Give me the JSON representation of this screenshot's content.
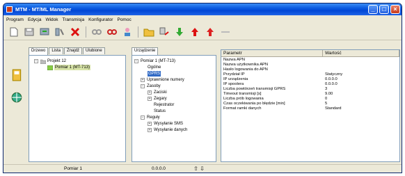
{
  "window": {
    "title": "MTM - MT/ML Manager",
    "minimize": "_",
    "maximize": "□",
    "close": "×"
  },
  "menu": [
    "Program",
    "Edycja",
    "Widok",
    "Transmisja",
    "Konfigurator",
    "Pomoc"
  ],
  "toolbar": {
    "icons": [
      "new-document-icon",
      "save-icon",
      "tree-connect-icon",
      "tree-disconnect-icon",
      "delete-icon",
      "link-icon",
      "link-red-icon",
      "user-icon",
      "folder-icon",
      "transfer-icon",
      "arrow-down-icon",
      "arrow-up-icon",
      "arrow-up-plus-icon",
      "minus-icon"
    ]
  },
  "left_panel": {
    "tabs": [
      "Drzewo",
      "Lista",
      "Znajdź",
      "Ulubione"
    ],
    "active_tab": "Drzewo",
    "tree": [
      {
        "label": "Projekt 12",
        "expander": "−"
      },
      {
        "label": "Pomiar 1 (MT-713)",
        "selected": true
      }
    ]
  },
  "mid_panel": {
    "tab": "Urządzenie",
    "tree": [
      {
        "label": "Pomiar 1 (MT-713)",
        "expander": "−"
      },
      {
        "label": "Ogólne"
      },
      {
        "label": "GPRS",
        "selected": true
      },
      {
        "label": "Uprawnione numery",
        "expander": "+"
      },
      {
        "label": "Zasoby",
        "expander": "−"
      },
      {
        "label": "Zaciski",
        "expander": "+"
      },
      {
        "label": "Zegary",
        "expander": "+"
      },
      {
        "label": "Rejestrator"
      },
      {
        "label": "Status"
      },
      {
        "label": "Reguły",
        "expander": "−"
      },
      {
        "label": "Wysyłanie SMS",
        "expander": "+"
      },
      {
        "label": "Wysyłanie danych",
        "expander": "+"
      }
    ]
  },
  "grid": {
    "headers": [
      "Parametr",
      "Wartość"
    ],
    "rows": [
      [
        "Nazwa APN",
        ""
      ],
      [
        "Nazwa użytkownika APN",
        ""
      ],
      [
        "Hasło logowania do APN",
        ""
      ],
      [
        "Przydział IP",
        "Statyczny"
      ],
      [
        "IP urządzenia",
        "0.0.0.0"
      ],
      [
        "IP spoolera",
        "0.0.0.0"
      ],
      [
        "Liczba powtórzeń transmisji GPRS",
        "3"
      ],
      [
        "Timeout transmisji [s]",
        "9.00"
      ],
      [
        "Liczba prób logowania",
        "0"
      ],
      [
        "Czas oczekiwania po błędzie [min]",
        "5"
      ],
      [
        "Format ramki danych",
        "Standard"
      ]
    ]
  },
  "status": {
    "left": "Pomiar 1",
    "middle": "0.0.0.0",
    "arrows": "⇧ ⇩"
  },
  "colors": {
    "title_bar": "#0a5ae0",
    "selection": "#316ac5",
    "window_bg": "#ece9d8"
  }
}
